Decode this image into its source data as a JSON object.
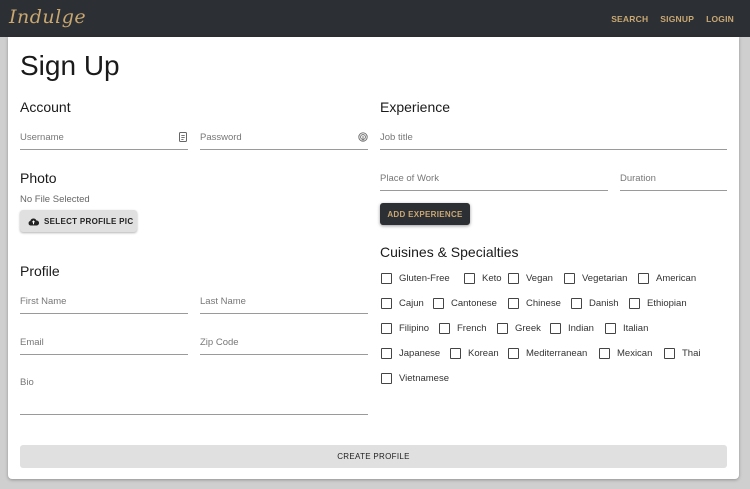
{
  "nav": {
    "logo": "Indulge",
    "links": [
      "SEARCH",
      "SIGNUP",
      "LOGIN"
    ]
  },
  "page_title": "Sign Up",
  "account": {
    "title": "Account",
    "username_label": "Username",
    "password_label": "Password"
  },
  "photo": {
    "title": "Photo",
    "status": "No File Selected",
    "button_label": "SELECT PROFILE PIC"
  },
  "profile": {
    "title": "Profile",
    "first_name_label": "First Name",
    "last_name_label": "Last Name",
    "email_label": "Email",
    "zip_label": "Zip Code",
    "bio_label": "Bio"
  },
  "experience": {
    "title": "Experience",
    "job_title_label": "Job title",
    "place_label": "Place of Work",
    "duration_label": "Duration",
    "button_label": "ADD EXPERIENCE"
  },
  "cuisines": {
    "title": "Cuisines & Specialties",
    "items": [
      "Gluten-Free",
      "Keto",
      "Vegan",
      "Vegetarian",
      "American",
      "Cajun",
      "Cantonese",
      "Chinese",
      "Danish",
      "Ethiopian",
      "Filipino",
      "French",
      "Greek",
      "Indian",
      "Italian",
      "Japanese",
      "Korean",
      "Mediterranean",
      "Mexican",
      "Thai",
      "Vietnamese"
    ]
  },
  "create_button_label": "CREATE PROFILE",
  "colors": {
    "nav_bg": "#2c2f33",
    "accent": "#c9a874",
    "card_bg": "#ffffff"
  }
}
